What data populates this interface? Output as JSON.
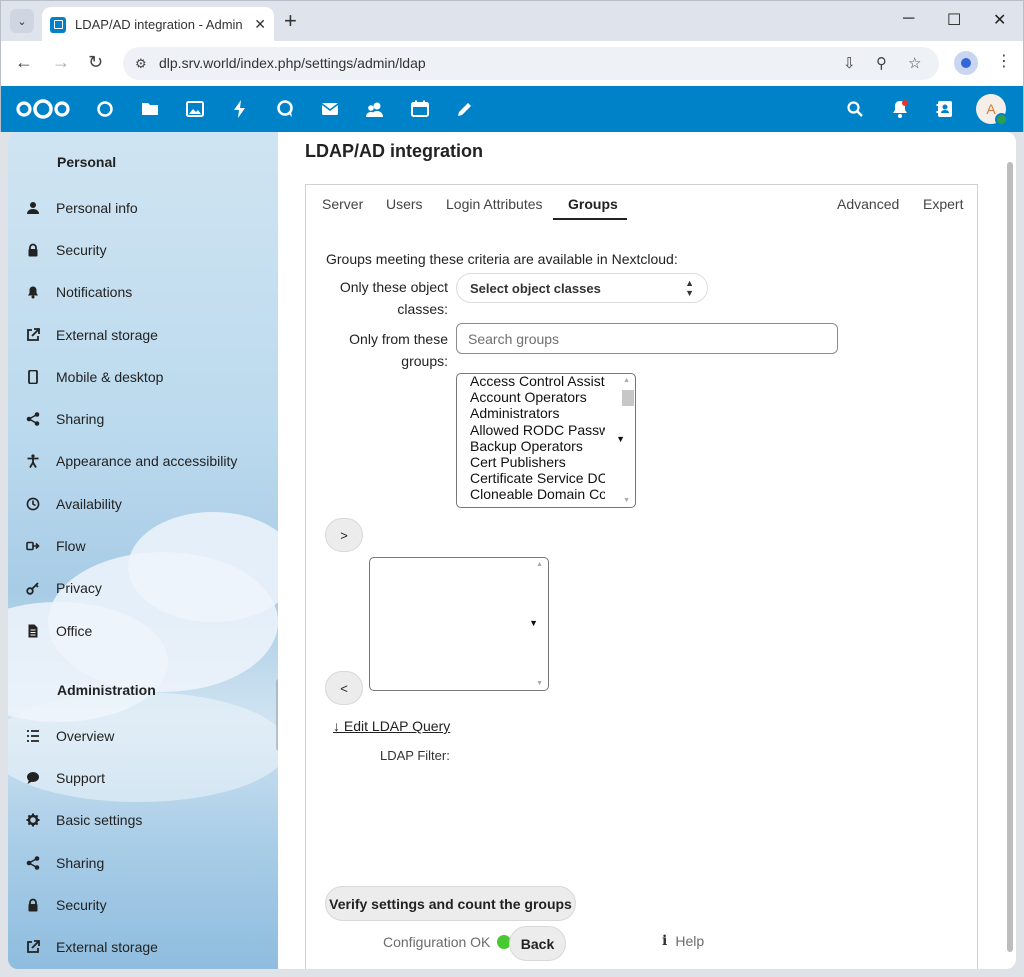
{
  "browser": {
    "tab_title": "LDAP/AD integration - Administration",
    "url": "dlp.srv.world/index.php/settings/admin/ldap",
    "new_tab": "+",
    "tab_close": "✕",
    "minimize": "─",
    "maximize": "☐",
    "close": "✕"
  },
  "sidebar": {
    "personal_heading": "Personal",
    "personal_items": [
      {
        "label": "Personal info",
        "icon": "person-icon"
      },
      {
        "label": "Security",
        "icon": "lock-icon"
      },
      {
        "label": "Notifications",
        "icon": "bell-icon"
      },
      {
        "label": "External storage",
        "icon": "external-link-icon"
      },
      {
        "label": "Mobile & desktop",
        "icon": "phone-icon"
      },
      {
        "label": "Sharing",
        "icon": "share-icon"
      },
      {
        "label": "Appearance and accessibility",
        "icon": "accessibility-icon"
      },
      {
        "label": "Availability",
        "icon": "clock-icon"
      },
      {
        "label": "Flow",
        "icon": "flow-icon"
      },
      {
        "label": "Privacy",
        "icon": "key-icon"
      },
      {
        "label": "Office",
        "icon": "document-icon"
      }
    ],
    "admin_heading": "Administration",
    "admin_items": [
      {
        "label": "Overview",
        "icon": "list-icon"
      },
      {
        "label": "Support",
        "icon": "chat-icon"
      },
      {
        "label": "Basic settings",
        "icon": "gear-icon"
      },
      {
        "label": "Sharing",
        "icon": "share-icon"
      },
      {
        "label": "Security",
        "icon": "lock-icon"
      },
      {
        "label": "External storage",
        "icon": "external-link-icon"
      }
    ]
  },
  "main": {
    "title": "LDAP/AD integration",
    "tabs": {
      "server": "Server",
      "users": "Users",
      "login_attributes": "Login Attributes",
      "groups": "Groups",
      "advanced": "Advanced",
      "expert": "Expert"
    },
    "intro": "Groups meeting these criteria are available in Nextcloud:",
    "object_classes_label_1": "Only these object",
    "object_classes_label_2": "classes:",
    "object_classes_select": "Select object classes",
    "groups_label_1": "Only from these",
    "groups_label_2": "groups:",
    "search_placeholder": "Search groups",
    "available_groups": [
      "Access Control Assistance Operators",
      "Account Operators",
      "Administrators",
      "Allowed RODC Password Replication Group",
      "Backup Operators",
      "Cert Publishers",
      "Certificate Service DCOM Access",
      "Cloneable Domain Controllers"
    ],
    "add_button": ">",
    "remove_button": "<",
    "edit_query": "↓ Edit LDAP Query",
    "ldap_filter_label": "LDAP Filter:",
    "verify_button": "Verify settings and count the groups",
    "config_status": "Configuration OK",
    "back_button": "Back",
    "help_link": "Help",
    "help_icon": "i"
  }
}
